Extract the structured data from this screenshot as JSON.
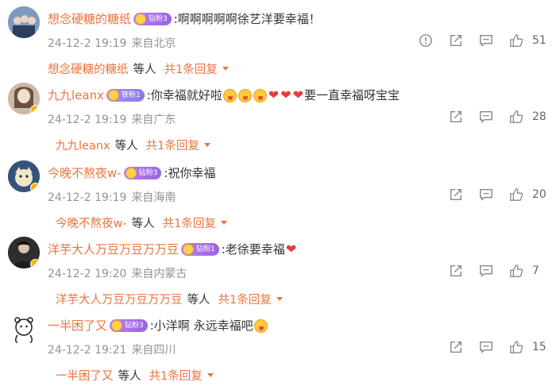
{
  "comments": [
    {
      "username": "想念硬糖的糖纸",
      "badge": "钻粉3",
      "text": ":啊啊啊啊啊徐艺洋要幸福！",
      "time": "24-12-2 19:19",
      "location": "来自北京",
      "likes": "51",
      "reply_user": "想念硬糖的糖纸",
      "reply_others": "等人",
      "reply_count": "共1条回复",
      "avatar_color": "#6a88b4"
    },
    {
      "username": "九九leanx",
      "badge": "铁粉1",
      "text_prefix": ":你幸福就好啦",
      "text_suffix": "要一直幸福呀宝宝",
      "time": "24-12-2 19:19",
      "location": "来自广东",
      "likes": "28",
      "reply_user": "九九leanx",
      "reply_others": "等人",
      "reply_count": "共1条回复",
      "avatar_color": "#c9a68e"
    },
    {
      "username": "今晚不熬夜w-",
      "badge": "钻粉3",
      "text": ":祝你幸福",
      "time": "24-12-2 19:19",
      "location": "来自海南",
      "likes": "20",
      "reply_user": "今晚不熬夜w-",
      "reply_others": "等人",
      "reply_count": "共1条回复",
      "avatar_color": "#3c5a82"
    },
    {
      "username": "洋芋大人万豆万豆万万豆",
      "badge": "钻粉1",
      "text": ":老徐要幸福",
      "time": "24-12-2 19:20",
      "location": "来自内蒙古",
      "likes": "7",
      "reply_user": "洋芋大人万豆万豆万万豆",
      "reply_others": "等人",
      "reply_count": "共1条回复",
      "avatar_color": "#3a3a3a"
    },
    {
      "username": "一半困了又",
      "badge": "钻粉3",
      "text": ":小洋啊 永远幸福吧",
      "time": "24-12-2 19:21",
      "location": "来自四川",
      "likes": "15",
      "reply_user": "一半困了又",
      "reply_others": "等人",
      "reply_count": "共1条回复",
      "avatar_color": "#f2f2f2"
    }
  ],
  "colors": {
    "username": "#eb7340",
    "meta": "#939393",
    "badge": "#a66ff0",
    "heart": "#e83b3b"
  }
}
